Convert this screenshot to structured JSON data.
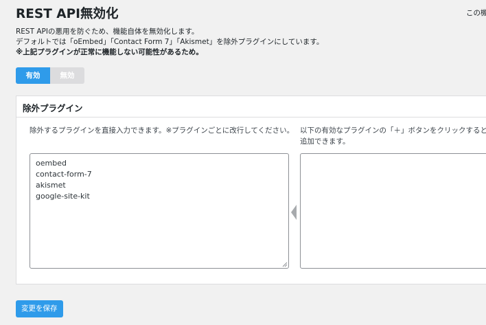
{
  "page": {
    "title": "REST API無効化",
    "top_right": "この機"
  },
  "description": {
    "line1": "REST APIの悪用を防ぐため、機能自体を無効化します。",
    "line2": "デフォルトでは「oEmbed」「Contact Form 7」「Akismet」を除外プラグインにしています。",
    "warning": "※上記プラグインが正常に機能しない可能性があるため。"
  },
  "toggle": {
    "on_label": "有効",
    "off_label": "無効",
    "selected": "有効"
  },
  "panel": {
    "title": "除外プラグイン",
    "left_hint": "除外するプラグインを直接入力できます。※プラグインごとに改行してください。",
    "right_hint_line1": "以下の有効なプラグインの「＋」ボタンをクリックすると、",
    "right_hint_line2": "追加できます。",
    "excluded_plugins": [
      "oembed",
      "contact-form-7",
      "akismet",
      "google-site-kit"
    ],
    "arrow_icon": "caret-left-icon"
  },
  "actions": {
    "save_label": "変更を保存"
  },
  "colors": {
    "accent": "#2f9bea",
    "background": "#f1f1f1"
  }
}
